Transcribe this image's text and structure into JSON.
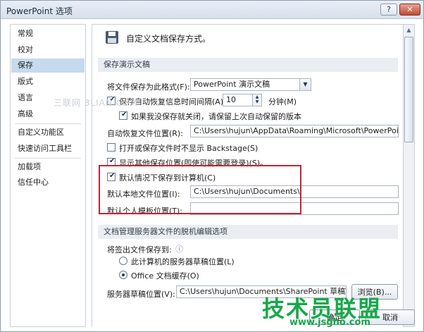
{
  "window": {
    "title": "PowerPoint 选项",
    "help_label": "?",
    "close_label": "✕"
  },
  "sidebar": {
    "items": [
      {
        "label": "常规"
      },
      {
        "label": "校对"
      },
      {
        "label": "保存",
        "active": true
      },
      {
        "label": "版式"
      },
      {
        "label": "语言"
      },
      {
        "label": "高级"
      },
      {
        "label": "自定义功能区"
      },
      {
        "label": "快速访问工具栏"
      },
      {
        "label": "加载项"
      },
      {
        "label": "信任中心"
      }
    ]
  },
  "main": {
    "header": "自定义文档保存方式。",
    "save_section": {
      "heading": "保存演示文稿",
      "format_label": "将文件保存为此格式(F):",
      "format_value": "PowerPoint 演示文稿",
      "autorecover_label": "保存自动恢复信息时间间隔(A)",
      "autorecover_checked": true,
      "autorecover_minutes": "10",
      "minutes_label": "分钟(M)",
      "keep_last_label": "如果我没保存就关闭，请保留上次自动保留的版本",
      "keep_last_checked": true,
      "autorecover_location_label": "自动恢复文件位置(R):",
      "autorecover_location_value": "C:\\Users\\hujun\\AppData\\Roaming\\Microsoft\\PowerPoint\\",
      "no_backstage_label": "打开或保存文件时不显示 Backstage(S)",
      "no_backstage_checked": false,
      "show_additional_label": "显示其他保存位置(即使可能需要登录)(S)。",
      "show_additional_checked": true,
      "save_to_computer_label": "默认情况下保存到计算机(C)",
      "save_to_computer_checked": true,
      "local_location_label": "默认本地文件位置(I):",
      "local_location_value": "C:\\Users\\hujun\\Documents\\",
      "template_location_label": "默认个人模板位置(T):",
      "template_location_value": ""
    },
    "offline_section": {
      "heading": "文档管理服务器文件的脱机编辑选项",
      "save_checked_out_label": "将签出文件保存到:",
      "info_icon": "ⓘ",
      "options": [
        {
          "label": "此计算机的服务器草稿位置(L)",
          "selected": false
        },
        {
          "label": "Office 文档缓存(O)",
          "selected": true
        }
      ],
      "drafts_location_label": "服务器草稿位置(V):",
      "drafts_location_value": "C:\\Users\\hujun\\Documents\\SharePoint 草稿\\",
      "browse_label": "浏览(B)..."
    }
  },
  "footer": {
    "ok_label": "确定",
    "cancel_label": "取消"
  },
  "watermarks": {
    "left_text": "三联网 3LIAN.COM",
    "logo_text": "技术员联盟",
    "url_text": "www.jsgho.com"
  },
  "colors": {
    "highlight_box": "#c8232f",
    "nav_active": "#c6d9ef",
    "watermark_green": "#17a84a"
  }
}
